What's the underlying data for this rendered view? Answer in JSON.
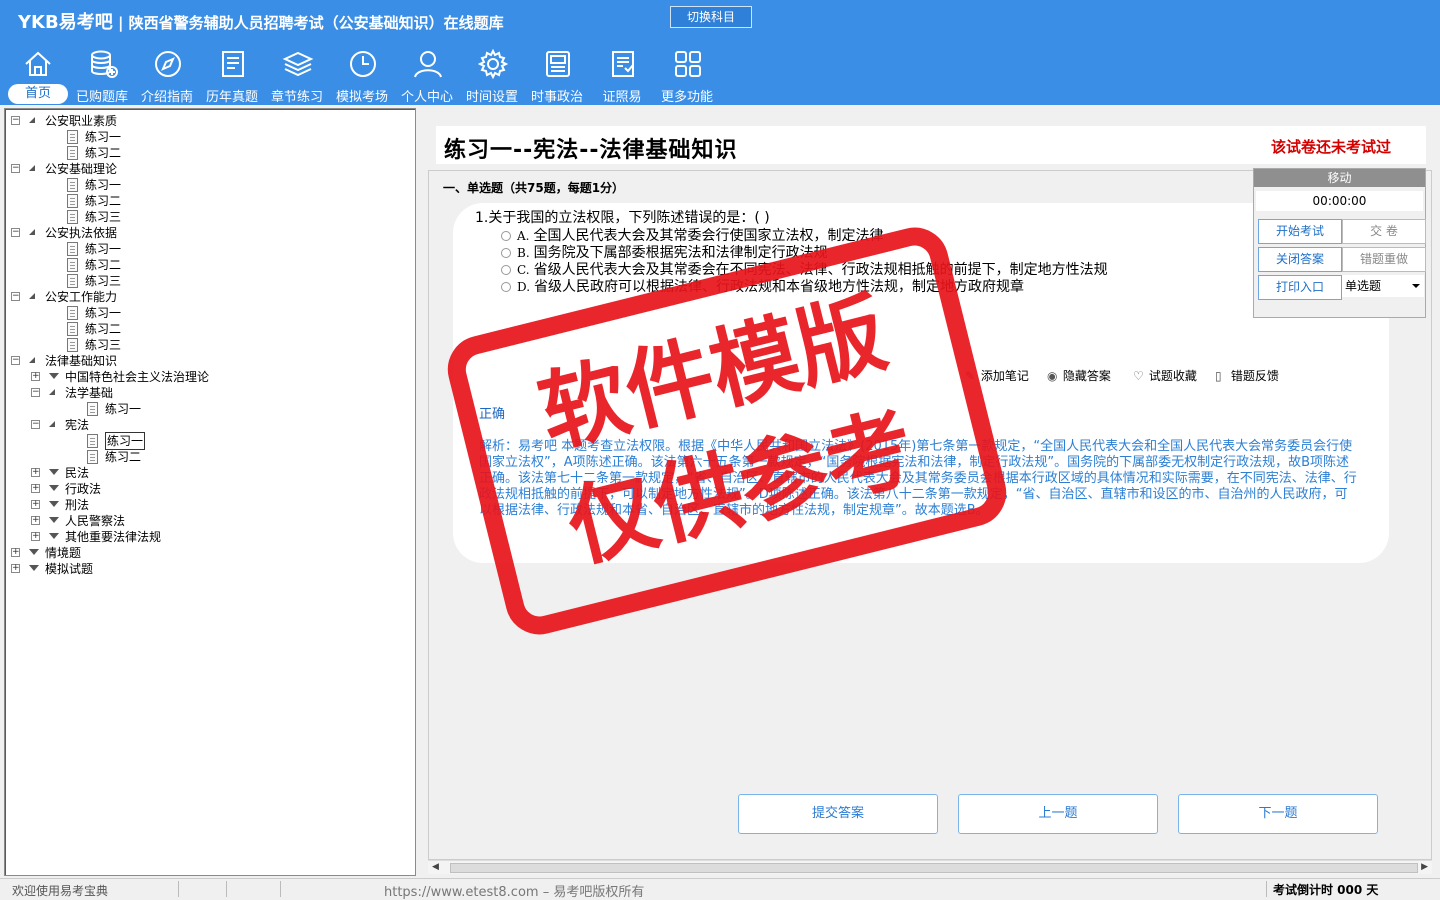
{
  "header": {
    "brand": "YKB易考吧",
    "title": "陕西省警务辅助人员招聘考试（公安基础知识）在线题库",
    "switch_subject": "切换科目"
  },
  "toolbar": [
    {
      "label": "首页",
      "icon": "home-icon",
      "active": true
    },
    {
      "label": "已购题库",
      "icon": "database-icon"
    },
    {
      "label": "介绍指南",
      "icon": "compass-icon"
    },
    {
      "label": "历年真题",
      "icon": "document-list-icon"
    },
    {
      "label": "章节练习",
      "icon": "layers-icon"
    },
    {
      "label": "模拟考场",
      "icon": "clock-icon"
    },
    {
      "label": "个人中心",
      "icon": "user-icon"
    },
    {
      "label": "时间设置",
      "icon": "gear-icon"
    },
    {
      "label": "时事政治",
      "icon": "news-icon"
    },
    {
      "label": "证照易",
      "icon": "certificate-icon"
    },
    {
      "label": "更多功能",
      "icon": "grid-icon"
    }
  ],
  "tree": [
    {
      "label": "公安职业素质",
      "depth": 0,
      "kind": "open"
    },
    {
      "label": "练习一",
      "depth": 1,
      "kind": "doc"
    },
    {
      "label": "练习二",
      "depth": 1,
      "kind": "doc"
    },
    {
      "label": "公安基础理论",
      "depth": 0,
      "kind": "open"
    },
    {
      "label": "练习一",
      "depth": 1,
      "kind": "doc"
    },
    {
      "label": "练习二",
      "depth": 1,
      "kind": "doc"
    },
    {
      "label": "练习三",
      "depth": 1,
      "kind": "doc"
    },
    {
      "label": "公安执法依据",
      "depth": 0,
      "kind": "open"
    },
    {
      "label": "练习一",
      "depth": 1,
      "kind": "doc"
    },
    {
      "label": "练习二",
      "depth": 1,
      "kind": "doc"
    },
    {
      "label": "练习三",
      "depth": 1,
      "kind": "doc"
    },
    {
      "label": "公安工作能力",
      "depth": 0,
      "kind": "open"
    },
    {
      "label": "练习一",
      "depth": 1,
      "kind": "doc"
    },
    {
      "label": "练习二",
      "depth": 1,
      "kind": "doc"
    },
    {
      "label": "练习三",
      "depth": 1,
      "kind": "doc"
    },
    {
      "label": "法律基础知识",
      "depth": 0,
      "kind": "open"
    },
    {
      "label": "中国特色社会主义法治理论",
      "depth": 1,
      "kind": "closed"
    },
    {
      "label": "法学基础",
      "depth": 1,
      "kind": "open"
    },
    {
      "label": "练习一",
      "depth": 2,
      "kind": "doc"
    },
    {
      "label": "宪法",
      "depth": 1,
      "kind": "open"
    },
    {
      "label": "练习一",
      "depth": 2,
      "kind": "doc",
      "selected": true
    },
    {
      "label": "练习二",
      "depth": 2,
      "kind": "doc"
    },
    {
      "label": "民法",
      "depth": 1,
      "kind": "closed"
    },
    {
      "label": "行政法",
      "depth": 1,
      "kind": "closed"
    },
    {
      "label": "刑法",
      "depth": 1,
      "kind": "closed"
    },
    {
      "label": "人民警察法",
      "depth": 1,
      "kind": "closed"
    },
    {
      "label": "其他重要法律法规",
      "depth": 1,
      "kind": "closed"
    },
    {
      "label": "情境题",
      "depth": 0,
      "kind": "closed"
    },
    {
      "label": "模拟试题",
      "depth": 0,
      "kind": "closed"
    }
  ],
  "paper": {
    "title": "练习一--宪法--法律基础知识",
    "status": "该试卷还未考试过",
    "section": "一、单选题（共75题，每题1分）"
  },
  "question": {
    "text": "1.关于我国的立法权限，下列陈述错误的是：( )",
    "options": [
      {
        "key": "A.",
        "text": "全国人民代表大会及其常委会行使国家立法权，制定法律"
      },
      {
        "key": "B.",
        "text": "国务院及下属部委根据宪法和法律制定行政法规"
      },
      {
        "key": "C.",
        "text": "省级人民代表大会及其常委会在不同宪法、法律、行政法规相抵触的前提下，制定地方性法规"
      },
      {
        "key": "D.",
        "text": "省级人民政府可以根据法律、行政法规和本省级地方性法规，制定地方政府规章"
      }
    ],
    "actions": [
      {
        "label": "添加笔记",
        "icon": "pencil-icon"
      },
      {
        "label": "隐藏答案",
        "icon": "eye-icon"
      },
      {
        "label": "试题收藏",
        "icon": "heart-icon"
      },
      {
        "label": "错题反馈",
        "icon": "feedback-icon"
      }
    ],
    "correct_label": "正确",
    "analysis": "解析：易考吧 本题考查立法权限。根据《中华人民共和国立法法》(2015年)第七条第一款规定，“全国人民代表大会和全国人民代表大会常务委员会行使国家立法权”，A项陈述正确。该法第六十五条第一款规定，“国务院根据宪法和法律，制定行政法规”。国务院的下属部委无权制定行政法规，故B项陈述正确。该法第七十二条第一款规定，“省、自治区、直辖市的人民代表大会及其常务委员会根据本行政区域的具体情况和实际需要，在不同宪法、法律、行政法规相抵触的前提下，可以制定地方性法规”。D项陈述正确。该法第八十二条第一款规定，“省、自治区、直辖市和设区的市、自治州的人民政府，可以根据法律、行政法规和本省、自治区、直辖市的地方性法规，制定规章”。故本题选B。"
  },
  "nav": {
    "submit": "提交答案",
    "prev": "上一题",
    "next": "下一题"
  },
  "panel": {
    "move": "移动",
    "timer": "00:00:00",
    "start": "开始考试",
    "hand_in": "交  卷",
    "close_answer": "关闭答案",
    "redo_wrong": "错题重做",
    "print": "打印入口",
    "question_type": "单选题"
  },
  "status": {
    "welcome": "欢迎使用易考宝典",
    "url": "https://www.etest8.com – 易考吧版权所有",
    "countdown": "考试倒计时 000 天"
  },
  "watermark": {
    "line1": "软件模版",
    "line2": "仅供参考"
  },
  "colors": {
    "topbar": "#3a8ee6",
    "accent_red": "#e8141b",
    "status_red": "#d40000",
    "link_blue": "#2c7fd4"
  }
}
